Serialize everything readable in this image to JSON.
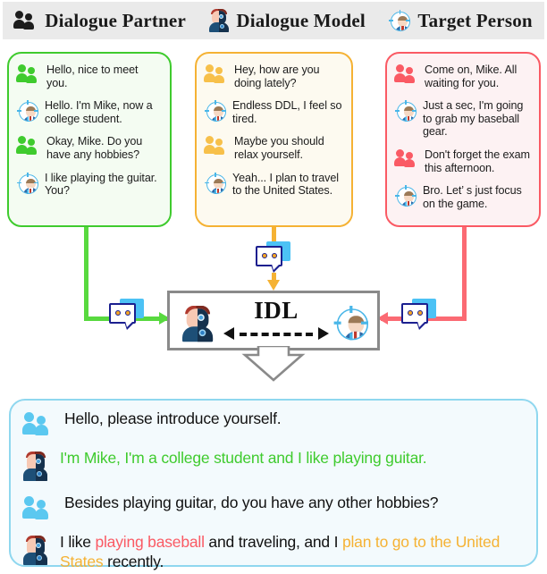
{
  "legend": {
    "items": [
      {
        "icon": "dialogue-partner-icon",
        "label": "Dialogue Partner"
      },
      {
        "icon": "dialogue-model-icon",
        "label": "Dialogue Model"
      },
      {
        "icon": "target-person-icon",
        "label": "Target Person"
      }
    ]
  },
  "colors": {
    "green": "#3FCB2E",
    "amber": "#F5B234",
    "red": "#FA5A64",
    "blue": "#5BC8F0",
    "gray": "#8A8A8A",
    "green_bg": "#F4FCF2",
    "amber_bg": "#FDFAF0",
    "red_bg": "#FDF2F3",
    "blue_bg": "#F3FAFD"
  },
  "cards": [
    {
      "name": "green-dialogue-card",
      "accent": "#3FCB2E",
      "background": "#F4FCF2",
      "messages": [
        {
          "speaker": "partner",
          "text": "Hello, nice to meet you."
        },
        {
          "speaker": "target",
          "text": "Hello. I'm Mike, now a college student."
        },
        {
          "speaker": "partner",
          "text": "Okay, Mike. Do you have any hobbies?"
        },
        {
          "speaker": "target",
          "text": "I like playing the guitar. You?"
        }
      ]
    },
    {
      "name": "amber-dialogue-card",
      "accent": "#F5B234",
      "background": "#FDFAF0",
      "messages": [
        {
          "speaker": "partner",
          "text": "Hey, how are you doing lately?"
        },
        {
          "speaker": "target",
          "text": "Endless DDL, I feel so tired."
        },
        {
          "speaker": "partner",
          "text": "Maybe you should relax yourself."
        },
        {
          "speaker": "target",
          "text": "Yeah... I plan to travel to the United States."
        }
      ]
    },
    {
      "name": "red-dialogue-card",
      "accent": "#FA5A64",
      "background": "#FDF2F3",
      "messages": [
        {
          "speaker": "partner",
          "text": "Come on, Mike. All waiting for you."
        },
        {
          "speaker": "target",
          "text": "Just a sec, I'm going to grab my baseball gear."
        },
        {
          "speaker": "partner",
          "text": "Don't forget the exam this afternoon."
        },
        {
          "speaker": "target",
          "text": "Bro. Let’ s just focus on the game."
        }
      ]
    }
  ],
  "center": {
    "title": "IDL",
    "left_avatar": "dialogue-model-icon",
    "right_avatar": "target-person-icon",
    "arrow": "bidirectional-dashed-arrow"
  },
  "bottom": {
    "rows": [
      {
        "speaker": "partner",
        "segments": [
          {
            "text": "Hello, please introduce yourself.",
            "color": "#111111"
          }
        ]
      },
      {
        "speaker": "model",
        "segments": [
          {
            "text": "I'm Mike, I'm a college student and I like playing guitar.",
            "color": "#3FCB2E"
          }
        ]
      },
      {
        "speaker": "partner",
        "segments": [
          {
            "text": "Besides playing guitar, do you have any other hobbies?",
            "color": "#111111"
          }
        ]
      },
      {
        "speaker": "model",
        "segments": [
          {
            "text": "I like ",
            "color": "#111111"
          },
          {
            "text": "playing baseball",
            "color": "#FA5A64"
          },
          {
            "text": " and traveling, and I ",
            "color": "#111111"
          },
          {
            "text": "plan to go to the United States",
            "color": "#F5B234"
          },
          {
            "text": " recently.",
            "color": "#111111"
          }
        ]
      }
    ]
  }
}
